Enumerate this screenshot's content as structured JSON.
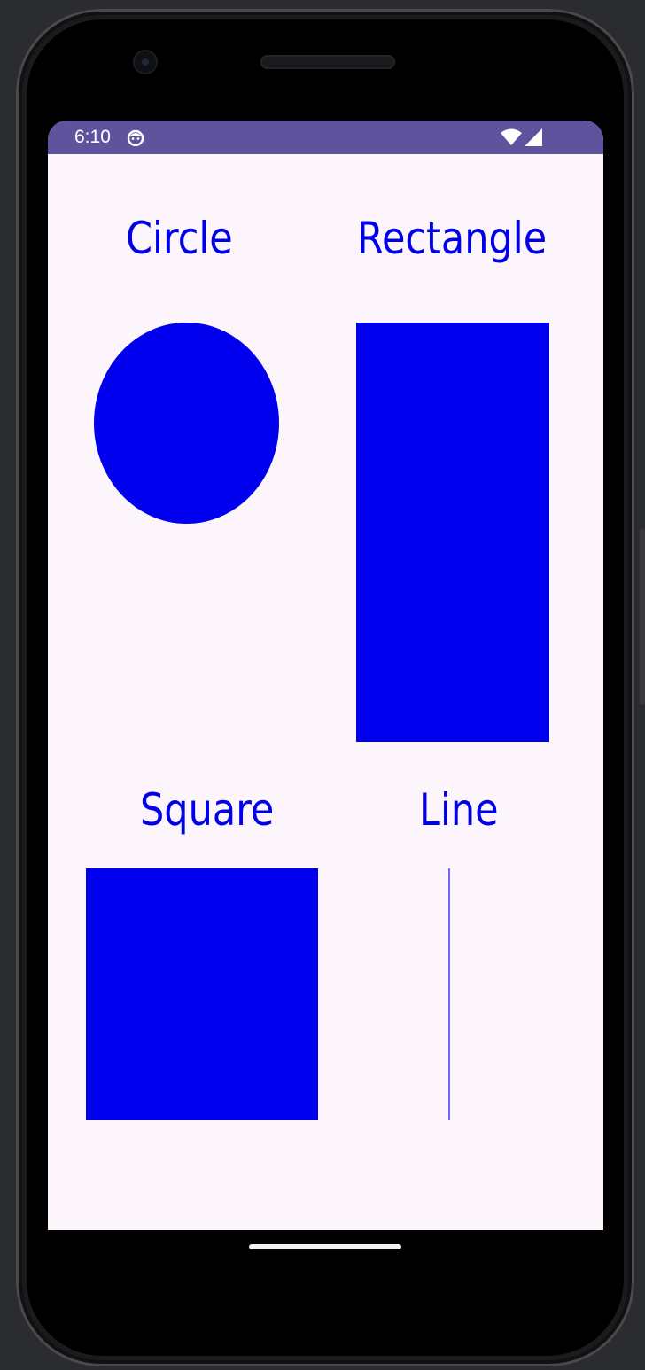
{
  "status_bar": {
    "time": "6:10",
    "app_icon": "android-app-icon",
    "wifi_icon": "wifi-icon",
    "signal_icon": "cell-signal-icon",
    "background_color": "#60539e"
  },
  "screen": {
    "background_color": "#fcf5fb"
  },
  "shapes": {
    "circle": {
      "label": "Circle",
      "color": "#0000ee"
    },
    "rectangle": {
      "label": "Rectangle",
      "color": "#0000ee"
    },
    "square": {
      "label": "Square",
      "color": "#0000ee"
    },
    "line": {
      "label": "Line",
      "color": "#6b6bf0"
    }
  },
  "label_color": "#0000e6",
  "navigation": {
    "home_handle": "home-gesture-handle"
  }
}
